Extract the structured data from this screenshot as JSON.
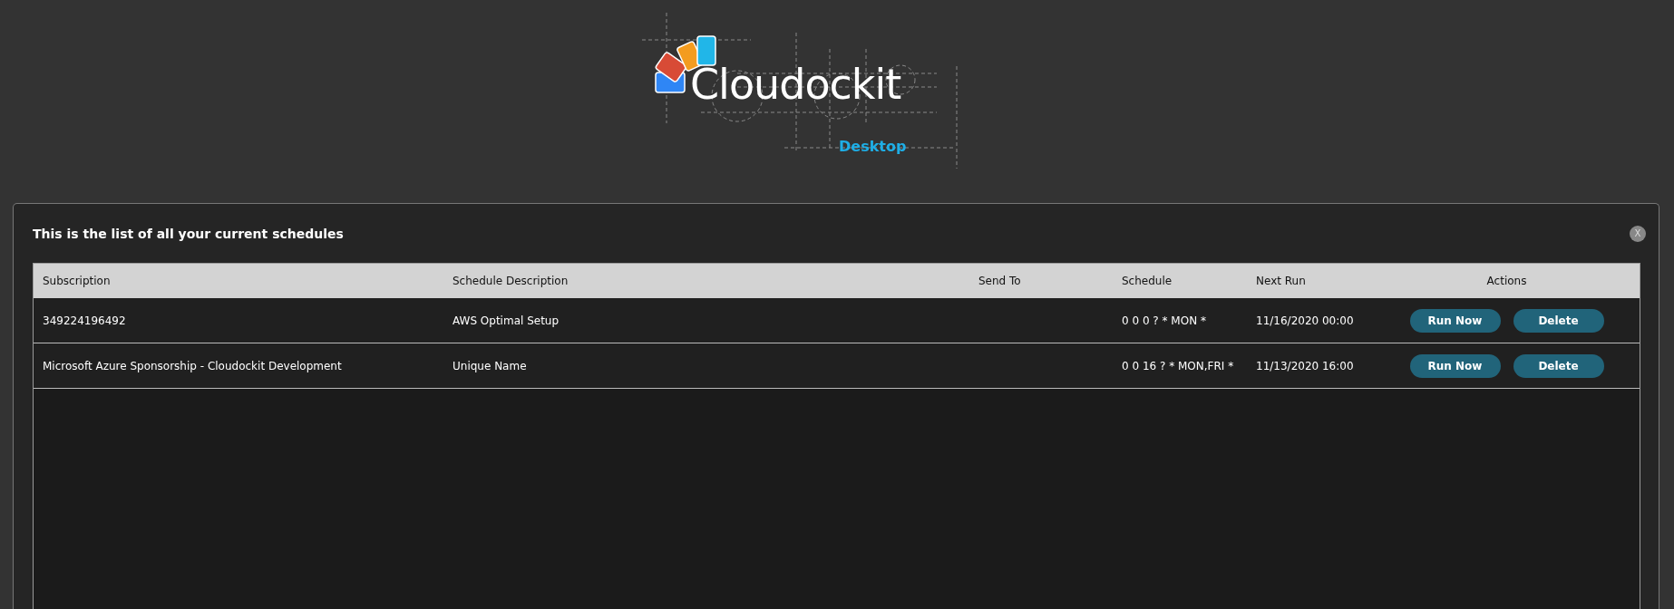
{
  "logo": {
    "name": "Cloudockit",
    "subtitle": "Desktop"
  },
  "panel": {
    "title": "This is the list of all your current schedules",
    "close": "X"
  },
  "table": {
    "columns": [
      "Subscription",
      "Schedule Description",
      "Send To",
      "Schedule",
      "Next Run",
      "Actions"
    ],
    "rows": [
      {
        "subscription": "349224196492",
        "description": "AWS Optimal Setup",
        "schedule": "0 0 0 ? * MON *",
        "next_run": "11/16/2020 00:00",
        "actions": [
          "Run Now",
          "Delete"
        ]
      },
      {
        "subscription": "Microsoft Azure Sponsorship - Cloudockit Development",
        "description": "Unique Name",
        "schedule": "0 0 16 ? * MON,FRI *",
        "next_run": "11/13/2020 16:00",
        "actions": [
          "Run Now",
          "Delete"
        ]
      }
    ]
  }
}
